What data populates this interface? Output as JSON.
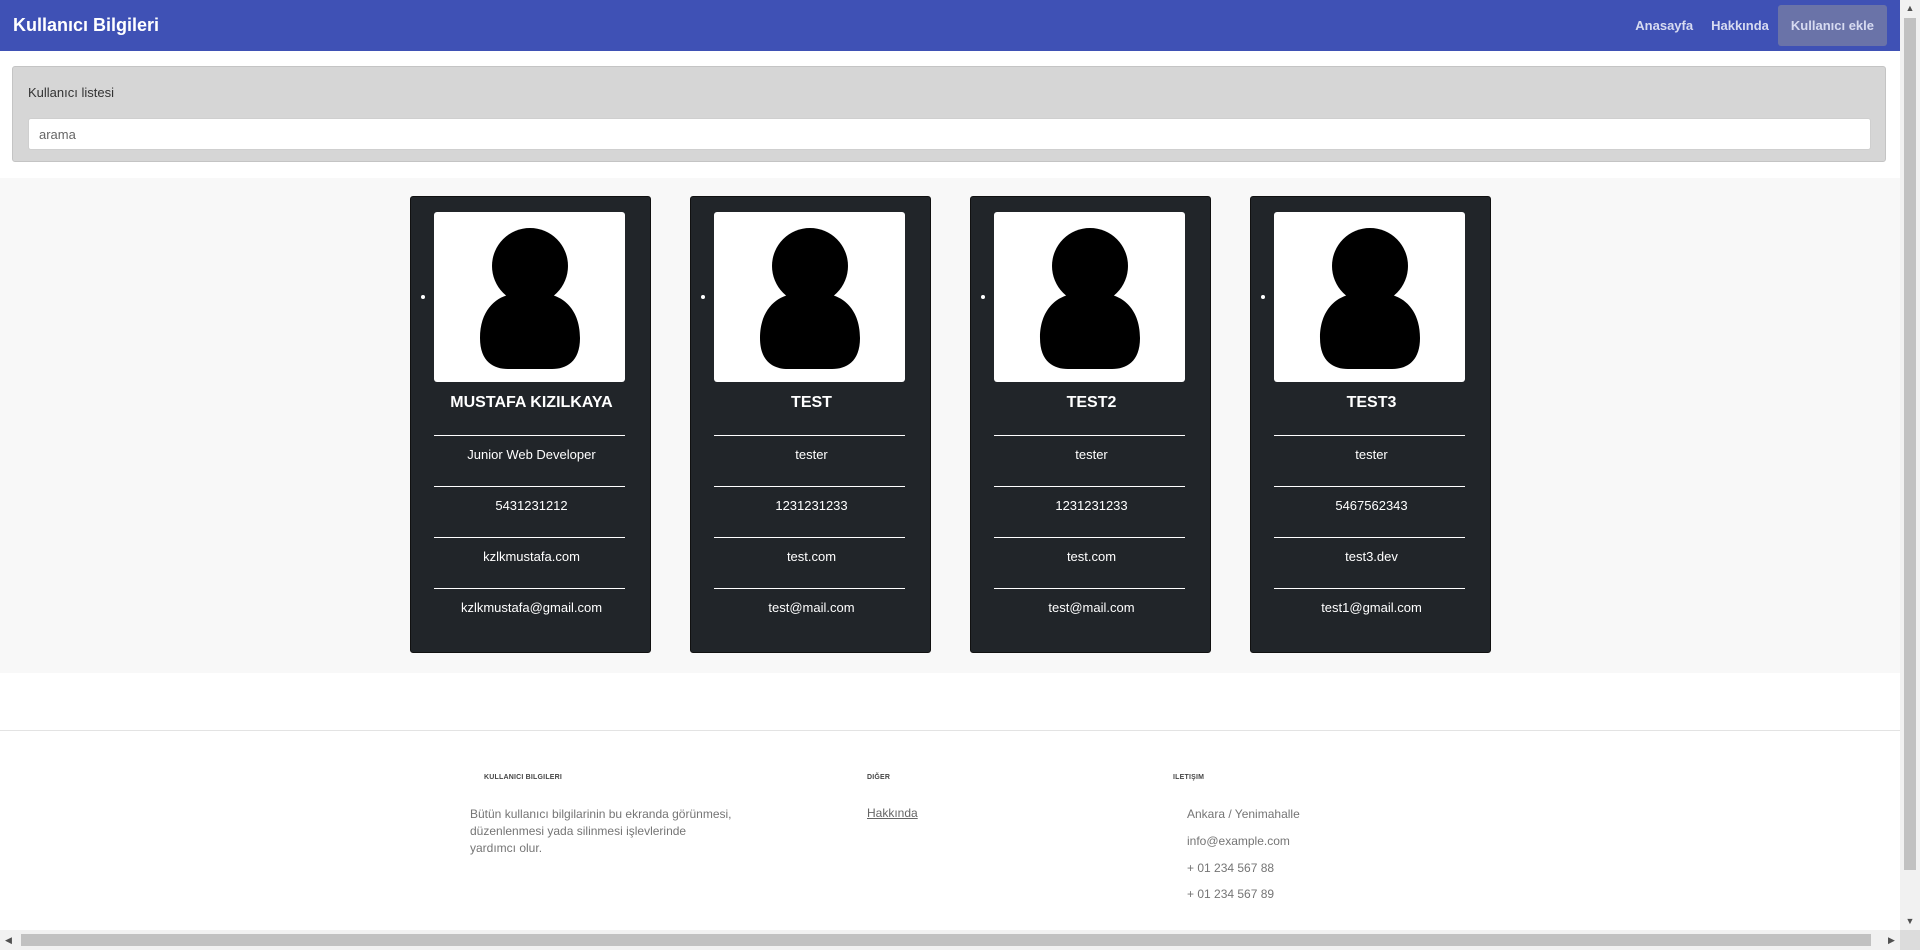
{
  "header": {
    "brand": "Kullanıcı Bilgileri",
    "nav": [
      {
        "label": "Anasayfa"
      },
      {
        "label": "Hakkında"
      },
      {
        "label": "Kullanıcı ekle"
      }
    ]
  },
  "search_panel": {
    "title": "Kullanıcı listesi",
    "placeholder": "arama"
  },
  "users": [
    {
      "name": "MUSTAFA KIZILKAYA",
      "title": "Junior Web Developer",
      "phone": "5431231212",
      "website": "kzlkmustafa.com",
      "email": "kzlkmustafa@gmail.com"
    },
    {
      "name": "TEST",
      "title": "tester",
      "phone": "1231231233",
      "website": "test.com",
      "email": "test@mail.com"
    },
    {
      "name": "TEST2",
      "title": "tester",
      "phone": "1231231233",
      "website": "test.com",
      "email": "test@mail.com"
    },
    {
      "name": "TEST3",
      "title": "tester",
      "phone": "5467562343",
      "website": "test3.dev",
      "email": "test1@gmail.com"
    }
  ],
  "footer": {
    "about": {
      "heading": "KULLANICI BILGILERI",
      "lines": [
        "Bütün kullanıcı bilgilarinin bu ekranda görünmesi,",
        "düzenlenmesi yada silinmesi işlevlerinde",
        "yardımcı olur."
      ]
    },
    "other": {
      "heading": "DIĞER",
      "link": "Hakkında"
    },
    "contact": {
      "heading": "ILETIŞIM",
      "address": "Ankara / Yenimahalle",
      "email": "info@example.com",
      "phone1": "+ 01 234 567 88",
      "phone2": "+ 01 234 567 89"
    }
  },
  "icons": {
    "user_avatar": "user-silhouette-icon",
    "scroll_up": "arrow-up-icon",
    "scroll_down": "arrow-down-icon",
    "scroll_left": "arrow-left-icon",
    "scroll_right": "arrow-right-icon"
  },
  "colors": {
    "header": "#3f51b5",
    "card": "#212529",
    "panel": "#d6d6d6"
  }
}
